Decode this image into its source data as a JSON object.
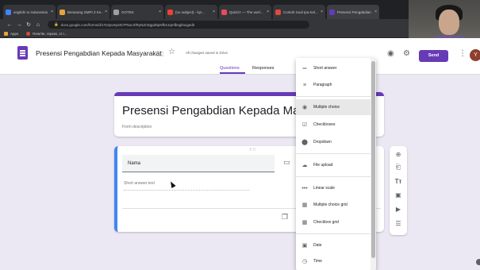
{
  "browser": {
    "tabs": [
      {
        "title": "englishi to indonesian",
        "color": "#4285f4"
      },
      {
        "title": "Beranang SMPI 3 Ke...",
        "color": "#e8a33d"
      },
      {
        "title": "GOTEK",
        "color": "#9aa0a6"
      },
      {
        "title": "(no subject) - kyr...",
        "color": "#ea4335"
      },
      {
        "title": "Quizizz — The worl...",
        "color": "#e84b5c"
      },
      {
        "title": "Contoh Soal Ipa Kel...",
        "color": "#d94b3d"
      },
      {
        "title": "Presensi Pengabdian",
        "color": "#673ab7"
      }
    ],
    "url": "docs.google.com/forms/d/1TcZpvmpOk7P5ucXfRyNZnDgpd5pNfkXJqmfbsgfeuigedit",
    "bookmarks": [
      "Apps",
      "Rewrite, repeat, or r..."
    ]
  },
  "header": {
    "doc_title": "Presensi Pengabdian Kepada Masyarakat",
    "saved_status": "All changes saved in Drive",
    "send_label": "Send",
    "avatar_letter": "Y",
    "tabs": {
      "questions": "Questions",
      "responses": "Responses"
    },
    "accent": "#673ab7"
  },
  "form": {
    "title": "Presensi Pengabdian Kepada Masyarakat",
    "description_placeholder": "Form description"
  },
  "question": {
    "title": "Nama",
    "answer_placeholder": "Short answer text"
  },
  "question_type_menu": {
    "items": [
      {
        "icon": "short-answer-icon",
        "glyph": "═",
        "label": "Short answer"
      },
      {
        "icon": "paragraph-icon",
        "glyph": "≡",
        "label": "Paragraph"
      },
      {
        "icon": "radio-icon",
        "glyph": "◉",
        "label": "Multiple choice",
        "selected": true
      },
      {
        "icon": "checkbox-icon",
        "glyph": "☑",
        "label": "Checkboxes"
      },
      {
        "icon": "dropdown-icon",
        "glyph": "⬤",
        "label": "Dropdown"
      },
      {
        "icon": "cloud-upload-icon",
        "glyph": "☁",
        "label": "File upload"
      },
      {
        "icon": "linear-scale-icon",
        "glyph": "•••",
        "label": "Linear scale"
      },
      {
        "icon": "grid-icon",
        "glyph": "▦",
        "label": "Multiple choice grid"
      },
      {
        "icon": "checkbox-grid-icon",
        "glyph": "▦",
        "label": "Checkbox grid"
      },
      {
        "icon": "calendar-icon",
        "glyph": "▣",
        "label": "Date"
      },
      {
        "icon": "clock-icon",
        "glyph": "◷",
        "label": "Time"
      }
    ]
  }
}
